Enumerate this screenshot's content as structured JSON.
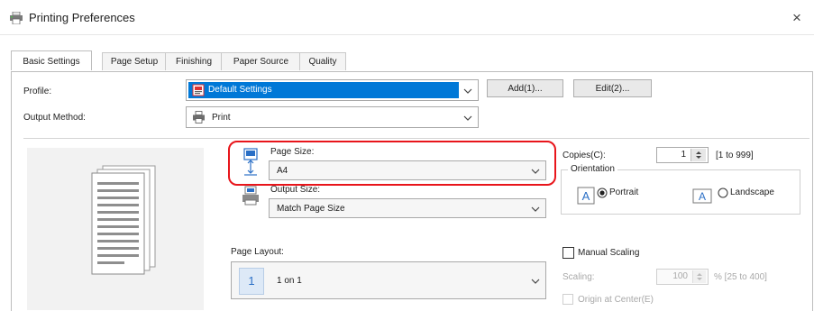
{
  "window": {
    "title": "Printing Preferences",
    "close_glyph": "×"
  },
  "tabs": [
    {
      "label": "Basic Settings",
      "active": true
    },
    {
      "label": "Page Setup",
      "active": false
    },
    {
      "label": "Finishing",
      "active": false
    },
    {
      "label": "Paper Source",
      "active": false
    },
    {
      "label": "Quality",
      "active": false
    }
  ],
  "profile": {
    "label": "Profile:",
    "value": "Default Settings",
    "add_label": "Add(1)...",
    "edit_label": "Edit(2)..."
  },
  "output_method": {
    "label": "Output Method:",
    "value": "Print"
  },
  "page_size": {
    "label": "Page Size:",
    "value": "A4"
  },
  "output_size": {
    "label": "Output Size:",
    "value": "Match Page Size"
  },
  "copies": {
    "label": "Copies(C):",
    "value": "1",
    "range": "[1 to 999]"
  },
  "orientation": {
    "label": "Orientation",
    "portrait_label": "Portrait",
    "landscape_label": "Landscape",
    "selected": "portrait"
  },
  "page_layout": {
    "label": "Page Layout:",
    "value": "1 on 1",
    "icon_digit": "1"
  },
  "manual_scaling": {
    "label": "Manual Scaling",
    "checked": false
  },
  "scaling": {
    "label": "Scaling:",
    "value": "100",
    "range": "% [25 to 400]",
    "origin_label": "Origin at Center(E)"
  },
  "colors": {
    "highlight": "#0078d7",
    "callout": "#e8151b"
  }
}
